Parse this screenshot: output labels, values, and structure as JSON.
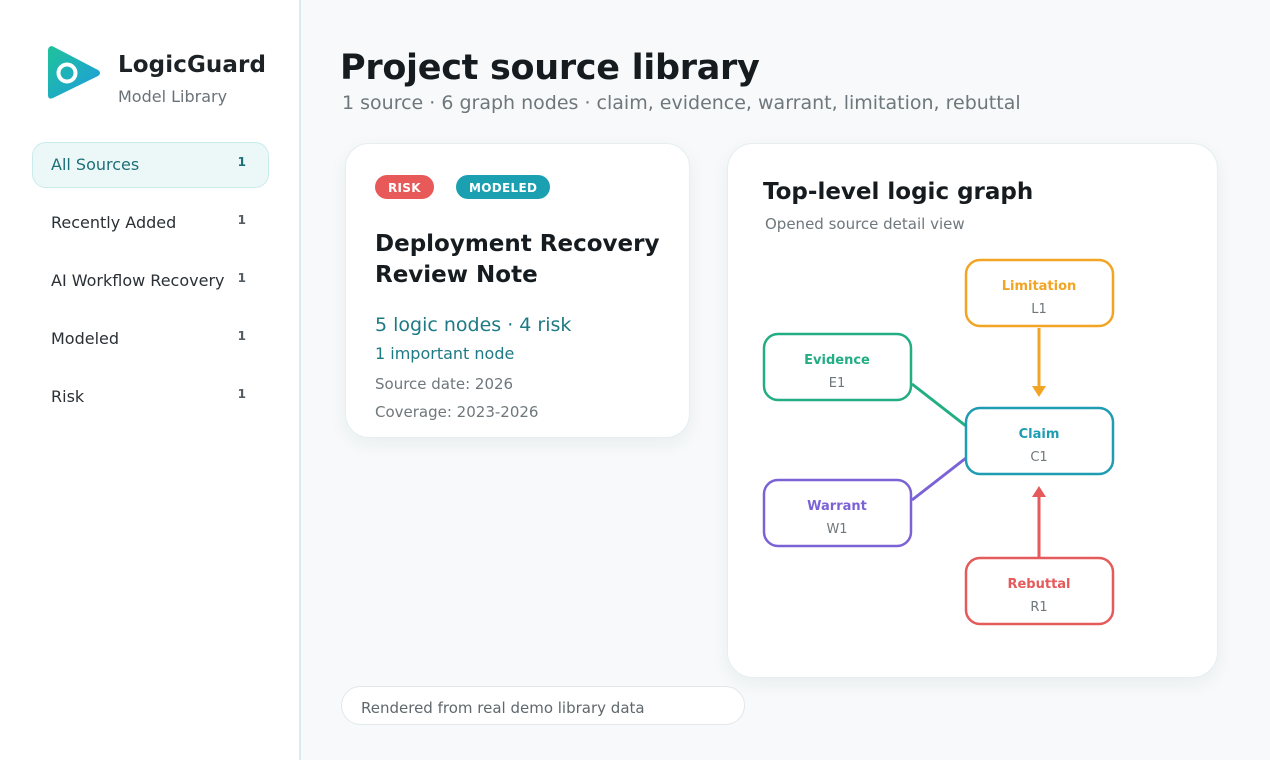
{
  "brand": {
    "name": "LogicGuard",
    "subtitle": "Model Library",
    "accent": "#16b3b1",
    "logo_icon": "play-logo-icon"
  },
  "sidebar": {
    "items": [
      {
        "label": "All Sources",
        "count": "1",
        "active": true
      },
      {
        "label": "Recently Added",
        "count": "1",
        "active": false
      },
      {
        "label": "AI Workflow Recovery",
        "count": "1",
        "active": false
      },
      {
        "label": "Modeled",
        "count": "1",
        "active": false
      },
      {
        "label": "Risk",
        "count": "1",
        "active": false
      }
    ]
  },
  "header": {
    "title": "Project source library",
    "subtitle": "1 source · 6 graph nodes · claim, evidence, warrant, limitation, rebuttal"
  },
  "source_card": {
    "badges": [
      {
        "label": "RISK",
        "color": "#e85a5a"
      },
      {
        "label": "MODELED",
        "color": "#1aa0b1"
      }
    ],
    "title": "Deployment Recovery Review Note",
    "metric": "5 logic nodes · 4 risk",
    "important": "1 important node",
    "source_date": "Source date: 2026",
    "coverage": "Coverage: 2023-2026"
  },
  "graph": {
    "title": "Top-level logic graph",
    "subtitle": "Opened source detail view",
    "nodes": [
      {
        "key": "limitation",
        "label": "Limitation",
        "id": "L1",
        "color": "#f2a524"
      },
      {
        "key": "evidence",
        "label": "Evidence",
        "id": "E1",
        "color": "#22ad83"
      },
      {
        "key": "claim",
        "label": "Claim",
        "id": "C1",
        "color": "#1e9db2"
      },
      {
        "key": "warrant",
        "label": "Warrant",
        "id": "W1",
        "color": "#7b63d6"
      },
      {
        "key": "rebuttal",
        "label": "Rebuttal",
        "id": "R1",
        "color": "#e55a5a"
      }
    ]
  },
  "footer": {
    "text": "Rendered from real demo library data"
  }
}
